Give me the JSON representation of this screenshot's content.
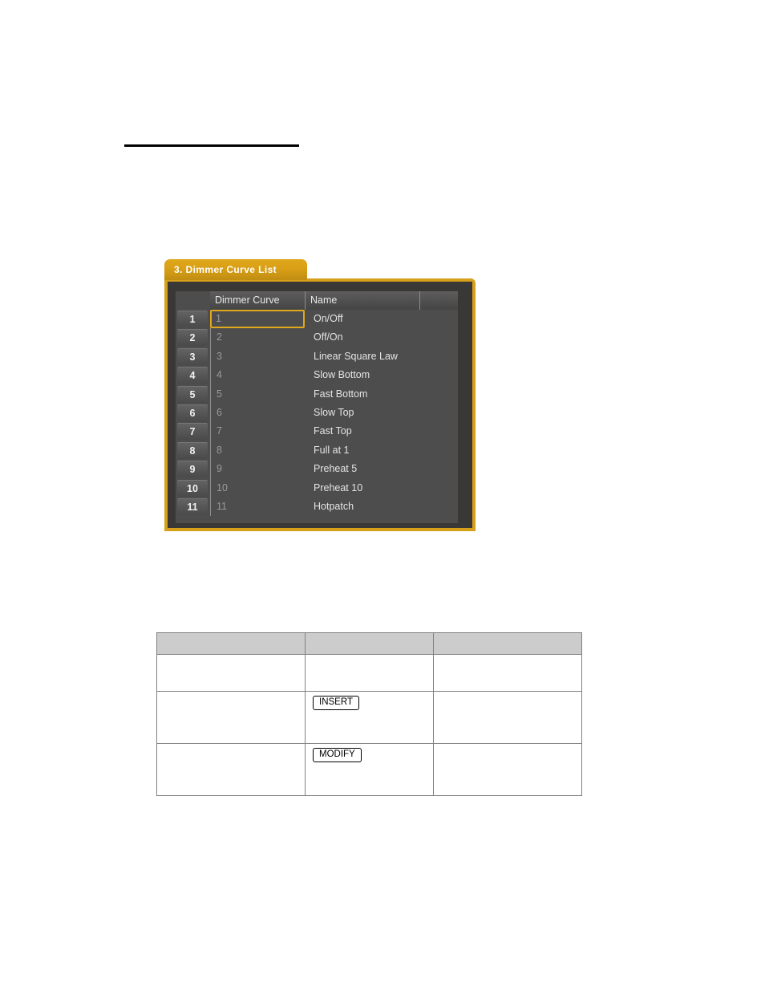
{
  "page": {
    "divider": "horizontal-rule"
  },
  "panel": {
    "tab_label": "3. Dimmer Curve List",
    "accent_color": "#d6a01a",
    "background_color": "#4d4d4d",
    "columns": [
      "Dimmer Curve",
      "Name"
    ],
    "selected_row": 1,
    "rows": [
      {
        "num": "1",
        "curve": "1",
        "name": "On/Off"
      },
      {
        "num": "2",
        "curve": "2",
        "name": "Off/On"
      },
      {
        "num": "3",
        "curve": "3",
        "name": "Linear Square Law"
      },
      {
        "num": "4",
        "curve": "4",
        "name": "Slow Bottom"
      },
      {
        "num": "5",
        "curve": "5",
        "name": "Fast Bottom"
      },
      {
        "num": "6",
        "curve": "6",
        "name": "Slow Top"
      },
      {
        "num": "7",
        "curve": "7",
        "name": "Fast Top"
      },
      {
        "num": "8",
        "curve": "8",
        "name": "Full at 1"
      },
      {
        "num": "9",
        "curve": "9",
        "name": "Preheat 5"
      },
      {
        "num": "10",
        "curve": "10",
        "name": "Preheat 10"
      },
      {
        "num": "11",
        "curve": "11",
        "name": "Hotpatch"
      }
    ]
  },
  "reference_table": {
    "headers": [
      "",
      "",
      ""
    ],
    "rows": [
      {
        "col_a": "",
        "col_b": "",
        "col_c": "",
        "button": ""
      },
      {
        "col_a": "",
        "col_b": "",
        "col_c": "",
        "button": "INSERT"
      },
      {
        "col_a": "",
        "col_b": "",
        "col_c": "",
        "button": "MODIFY"
      }
    ]
  }
}
